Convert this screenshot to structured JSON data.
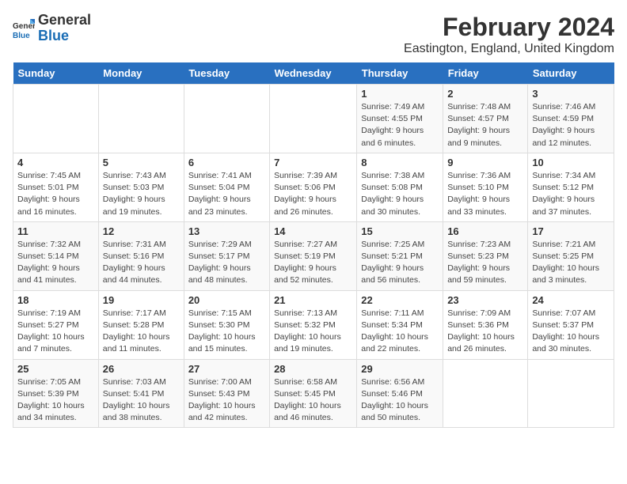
{
  "logo": {
    "general": "General",
    "blue": "Blue"
  },
  "title": "February 2024",
  "subtitle": "Eastington, England, United Kingdom",
  "headers": [
    "Sunday",
    "Monday",
    "Tuesday",
    "Wednesday",
    "Thursday",
    "Friday",
    "Saturday"
  ],
  "weeks": [
    [
      {
        "day": "",
        "info": ""
      },
      {
        "day": "",
        "info": ""
      },
      {
        "day": "",
        "info": ""
      },
      {
        "day": "",
        "info": ""
      },
      {
        "day": "1",
        "info": "Sunrise: 7:49 AM\nSunset: 4:55 PM\nDaylight: 9 hours\nand 6 minutes."
      },
      {
        "day": "2",
        "info": "Sunrise: 7:48 AM\nSunset: 4:57 PM\nDaylight: 9 hours\nand 9 minutes."
      },
      {
        "day": "3",
        "info": "Sunrise: 7:46 AM\nSunset: 4:59 PM\nDaylight: 9 hours\nand 12 minutes."
      }
    ],
    [
      {
        "day": "4",
        "info": "Sunrise: 7:45 AM\nSunset: 5:01 PM\nDaylight: 9 hours\nand 16 minutes."
      },
      {
        "day": "5",
        "info": "Sunrise: 7:43 AM\nSunset: 5:03 PM\nDaylight: 9 hours\nand 19 minutes."
      },
      {
        "day": "6",
        "info": "Sunrise: 7:41 AM\nSunset: 5:04 PM\nDaylight: 9 hours\nand 23 minutes."
      },
      {
        "day": "7",
        "info": "Sunrise: 7:39 AM\nSunset: 5:06 PM\nDaylight: 9 hours\nand 26 minutes."
      },
      {
        "day": "8",
        "info": "Sunrise: 7:38 AM\nSunset: 5:08 PM\nDaylight: 9 hours\nand 30 minutes."
      },
      {
        "day": "9",
        "info": "Sunrise: 7:36 AM\nSunset: 5:10 PM\nDaylight: 9 hours\nand 33 minutes."
      },
      {
        "day": "10",
        "info": "Sunrise: 7:34 AM\nSunset: 5:12 PM\nDaylight: 9 hours\nand 37 minutes."
      }
    ],
    [
      {
        "day": "11",
        "info": "Sunrise: 7:32 AM\nSunset: 5:14 PM\nDaylight: 9 hours\nand 41 minutes."
      },
      {
        "day": "12",
        "info": "Sunrise: 7:31 AM\nSunset: 5:16 PM\nDaylight: 9 hours\nand 44 minutes."
      },
      {
        "day": "13",
        "info": "Sunrise: 7:29 AM\nSunset: 5:17 PM\nDaylight: 9 hours\nand 48 minutes."
      },
      {
        "day": "14",
        "info": "Sunrise: 7:27 AM\nSunset: 5:19 PM\nDaylight: 9 hours\nand 52 minutes."
      },
      {
        "day": "15",
        "info": "Sunrise: 7:25 AM\nSunset: 5:21 PM\nDaylight: 9 hours\nand 56 minutes."
      },
      {
        "day": "16",
        "info": "Sunrise: 7:23 AM\nSunset: 5:23 PM\nDaylight: 9 hours\nand 59 minutes."
      },
      {
        "day": "17",
        "info": "Sunrise: 7:21 AM\nSunset: 5:25 PM\nDaylight: 10 hours\nand 3 minutes."
      }
    ],
    [
      {
        "day": "18",
        "info": "Sunrise: 7:19 AM\nSunset: 5:27 PM\nDaylight: 10 hours\nand 7 minutes."
      },
      {
        "day": "19",
        "info": "Sunrise: 7:17 AM\nSunset: 5:28 PM\nDaylight: 10 hours\nand 11 minutes."
      },
      {
        "day": "20",
        "info": "Sunrise: 7:15 AM\nSunset: 5:30 PM\nDaylight: 10 hours\nand 15 minutes."
      },
      {
        "day": "21",
        "info": "Sunrise: 7:13 AM\nSunset: 5:32 PM\nDaylight: 10 hours\nand 19 minutes."
      },
      {
        "day": "22",
        "info": "Sunrise: 7:11 AM\nSunset: 5:34 PM\nDaylight: 10 hours\nand 22 minutes."
      },
      {
        "day": "23",
        "info": "Sunrise: 7:09 AM\nSunset: 5:36 PM\nDaylight: 10 hours\nand 26 minutes."
      },
      {
        "day": "24",
        "info": "Sunrise: 7:07 AM\nSunset: 5:37 PM\nDaylight: 10 hours\nand 30 minutes."
      }
    ],
    [
      {
        "day": "25",
        "info": "Sunrise: 7:05 AM\nSunset: 5:39 PM\nDaylight: 10 hours\nand 34 minutes."
      },
      {
        "day": "26",
        "info": "Sunrise: 7:03 AM\nSunset: 5:41 PM\nDaylight: 10 hours\nand 38 minutes."
      },
      {
        "day": "27",
        "info": "Sunrise: 7:00 AM\nSunset: 5:43 PM\nDaylight: 10 hours\nand 42 minutes."
      },
      {
        "day": "28",
        "info": "Sunrise: 6:58 AM\nSunset: 5:45 PM\nDaylight: 10 hours\nand 46 minutes."
      },
      {
        "day": "29",
        "info": "Sunrise: 6:56 AM\nSunset: 5:46 PM\nDaylight: 10 hours\nand 50 minutes."
      },
      {
        "day": "",
        "info": ""
      },
      {
        "day": "",
        "info": ""
      }
    ]
  ]
}
